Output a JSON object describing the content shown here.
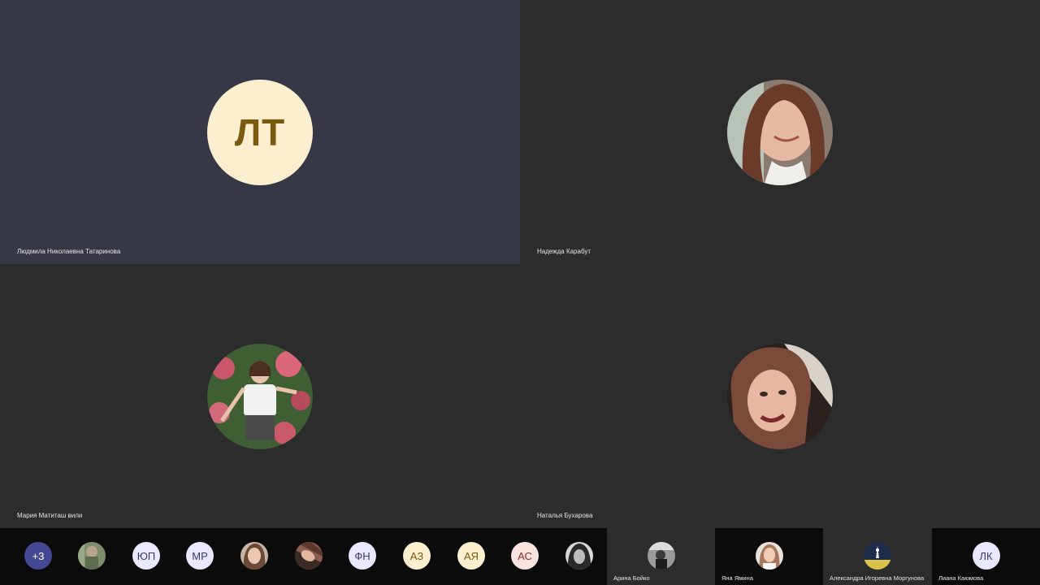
{
  "main_tiles": [
    {
      "name": "Людмила Николаевна Татаринова",
      "initials": "ЛТ",
      "avatar_bg": "#fbefd0",
      "avatar_fg": "#7a5a10",
      "tile_bg": "#363945"
    },
    {
      "name": "Надежда Карабут",
      "tile_bg": "#2c2c2c"
    },
    {
      "name": "Мария Матиташ вили",
      "tile_bg": "#2c2c2c"
    },
    {
      "name": "Наталья Бухарова",
      "tile_bg": "#2c2c2c"
    }
  ],
  "strip": {
    "overflow_label": "+3",
    "avatars": [
      {
        "type": "photo"
      },
      {
        "type": "initials",
        "text": "ЮП",
        "bg": "#e9e8ff",
        "fg": "#3b3a6b"
      },
      {
        "type": "initials",
        "text": "МР",
        "bg": "#e9e8ff",
        "fg": "#3b3a6b"
      },
      {
        "type": "photo"
      },
      {
        "type": "photo"
      },
      {
        "type": "initials",
        "text": "ФН",
        "bg": "#e9e8ff",
        "fg": "#3b3a6b"
      },
      {
        "type": "initials",
        "text": "АЗ",
        "bg": "#fbefd0",
        "fg": "#7a5a10"
      },
      {
        "type": "initials",
        "text": "АЯ",
        "bg": "#fbefd0",
        "fg": "#7a5a10"
      },
      {
        "type": "initials",
        "text": "АС",
        "bg": "#fbe3e0",
        "fg": "#8a2f24"
      },
      {
        "type": "photo"
      }
    ],
    "side_tiles": [
      {
        "name": "Арина Бойко",
        "type": "photo"
      },
      {
        "name": "Яна Ямина",
        "type": "photo"
      },
      {
        "name": "Александра Игоревна Моргунова",
        "type": "photo"
      },
      {
        "name": "Лиана Каюмова",
        "type": "initials",
        "initials": "ЛК",
        "bg": "#e9e8ff",
        "fg": "#3b3a6b"
      }
    ]
  }
}
